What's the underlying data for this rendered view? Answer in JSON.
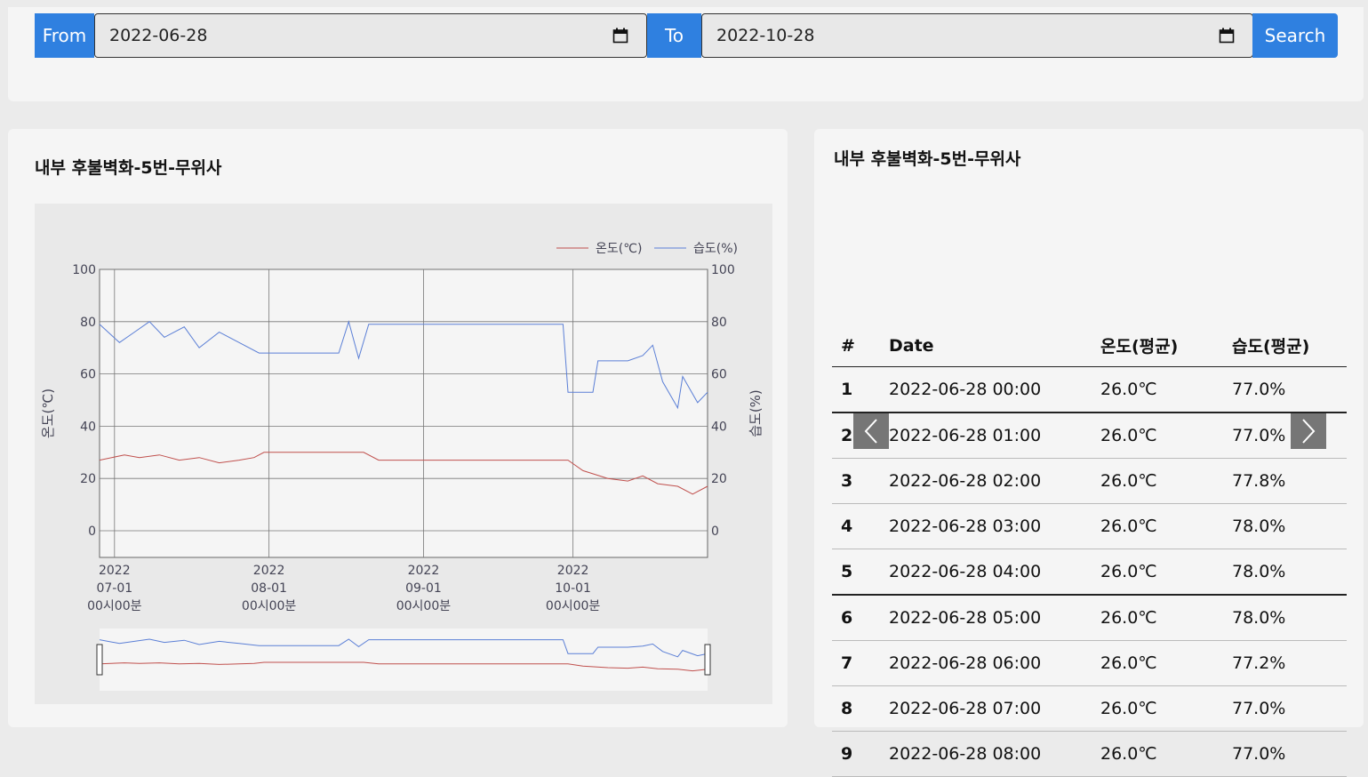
{
  "filter": {
    "from_label": "From",
    "from_value": "2022-06-28",
    "to_label": "To",
    "to_value": "2022-10-28",
    "search_label": "Search"
  },
  "chart_card": {
    "title": "내부 후불벽화-5번-무위사"
  },
  "table_card": {
    "title": "내부 후불벽화-5번-무위사"
  },
  "table": {
    "headers": [
      "#",
      "Date",
      "온도(평균)",
      "습도(평균)"
    ],
    "rows": [
      [
        "1",
        "2022-06-28 00:00",
        "26.0℃",
        "77.0%"
      ],
      [
        "2",
        "2022-06-28 01:00",
        "26.0℃",
        "77.0%"
      ],
      [
        "3",
        "2022-06-28 02:00",
        "26.0℃",
        "77.8%"
      ],
      [
        "4",
        "2022-06-28 03:00",
        "26.0℃",
        "78.0%"
      ],
      [
        "5",
        "2022-06-28 04:00",
        "26.0℃",
        "78.0%"
      ],
      [
        "6",
        "2022-06-28 05:00",
        "26.0℃",
        "78.0%"
      ],
      [
        "7",
        "2022-06-28 06:00",
        "26.0℃",
        "77.2%"
      ],
      [
        "8",
        "2022-06-28 07:00",
        "26.0℃",
        "77.0%"
      ],
      [
        "9",
        "2022-06-28 08:00",
        "26.0℃",
        "77.0%"
      ]
    ]
  },
  "icons": {
    "calendar": "calendar-icon",
    "prev": "chevron-left-icon",
    "next": "chevron-right-icon"
  },
  "colors": {
    "accent": "#2f80e0",
    "temperature": "#c0504d",
    "humidity": "#5b7fd6"
  },
  "chart_data": {
    "type": "line",
    "legend": [
      "온도(℃)",
      "습도(%)"
    ],
    "legend_position": "top-right",
    "ylabel_left": "온도(℃)",
    "ylabel_right": "습도(%)",
    "ylim": [
      0,
      100
    ],
    "yticks": [
      0,
      20,
      40,
      60,
      80,
      100
    ],
    "xticks": [
      [
        "2022",
        "07-01",
        "00시00분"
      ],
      [
        "2022",
        "08-01",
        "00시00분"
      ],
      [
        "2022",
        "09-01",
        "00시00분"
      ],
      [
        "2022",
        "10-01",
        "00시00분"
      ]
    ],
    "xtick_dates": [
      "2022-07-01",
      "2022-08-01",
      "2022-09-01",
      "2022-10-01"
    ],
    "x_range": [
      "2022-06-28",
      "2022-10-28"
    ],
    "grid": true,
    "series": [
      {
        "name": "온도(℃)",
        "x": [
          "2022-06-28",
          "2022-07-03",
          "2022-07-06",
          "2022-07-10",
          "2022-07-14",
          "2022-07-18",
          "2022-07-22",
          "2022-07-26",
          "2022-07-29",
          "2022-07-31",
          "2022-08-10",
          "2022-08-20",
          "2022-08-23",
          "2022-08-26",
          "2022-09-10",
          "2022-09-25",
          "2022-09-30",
          "2022-10-03",
          "2022-10-08",
          "2022-10-12",
          "2022-10-15",
          "2022-10-18",
          "2022-10-22",
          "2022-10-25",
          "2022-10-28"
        ],
        "values": [
          27,
          29,
          28,
          29,
          27,
          28,
          26,
          27,
          28,
          30,
          30,
          30,
          27,
          27,
          27,
          27,
          27,
          23,
          20,
          19,
          21,
          18,
          17,
          14,
          17
        ]
      },
      {
        "name": "습도(%)",
        "x": [
          "2022-06-28",
          "2022-07-02",
          "2022-07-05",
          "2022-07-08",
          "2022-07-11",
          "2022-07-15",
          "2022-07-18",
          "2022-07-22",
          "2022-07-26",
          "2022-07-30",
          "2022-07-31",
          "2022-08-10",
          "2022-08-15",
          "2022-08-17",
          "2022-08-19",
          "2022-08-21",
          "2022-08-22",
          "2022-09-10",
          "2022-09-29",
          "2022-09-30",
          "2022-10-05",
          "2022-10-06",
          "2022-10-12",
          "2022-10-15",
          "2022-10-17",
          "2022-10-19",
          "2022-10-22",
          "2022-10-23",
          "2022-10-26",
          "2022-10-28"
        ],
        "values": [
          79,
          72,
          76,
          80,
          74,
          78,
          70,
          76,
          72,
          68,
          68,
          68,
          68,
          80,
          66,
          79,
          79,
          79,
          79,
          53,
          53,
          65,
          65,
          67,
          71,
          57,
          47,
          59,
          49,
          53
        ]
      }
    ]
  }
}
